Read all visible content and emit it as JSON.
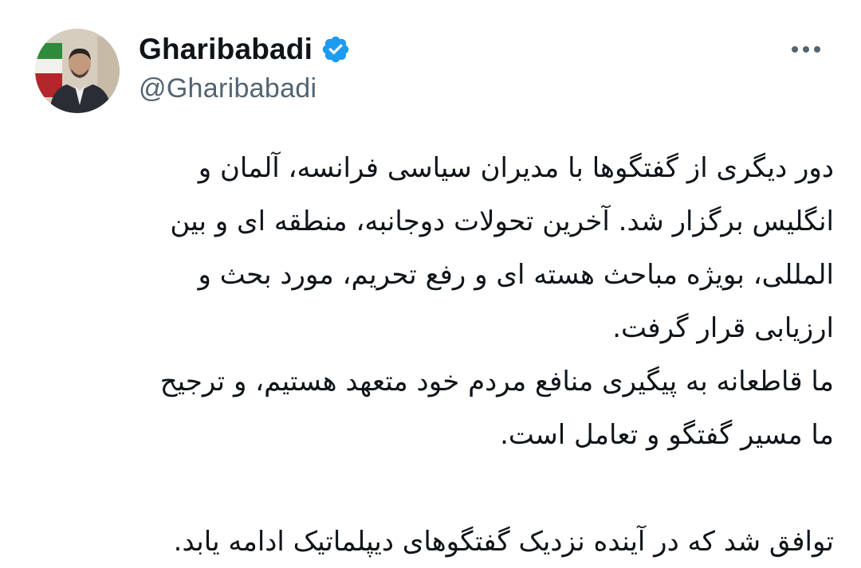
{
  "author": {
    "display_name": "Gharibabadi",
    "handle": "@Gharibabadi",
    "verified": true,
    "verified_color": "#1d9bf0"
  },
  "icons": {
    "avatar": "profile-photo",
    "verified": "verified-badge-icon",
    "more": "more-options-icon"
  },
  "tweet": {
    "lines": [
      "دور دیگری از گفتگوها با مدیران سیاسی فرانسه، آلمان و",
      "انگلیس برگزار شد. آخرین تحولات دوجانبه، منطقه ای و بین",
      "المللی، بویژه مباحث هسته ای و رفع تحریم، مورد بحث و",
      "ارزیابی قرار گرفت.",
      "ما قاطعانه به پیگیری منافع مردم خود متعهد هستیم، و ترجیح",
      "ما مسیر گفتگو و تعامل است.",
      "",
      "توافق شد که در آینده نزدیک گفتگوهای دیپلماتیک ادامه یابد."
    ]
  }
}
